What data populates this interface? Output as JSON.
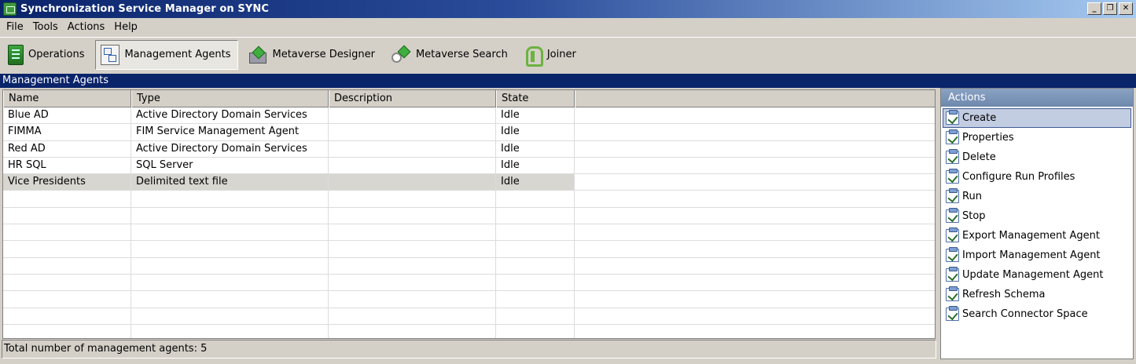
{
  "window": {
    "title": "Synchronization Service Manager on SYNC",
    "controls": {
      "minimize": "_",
      "restore": "❐",
      "close": "✕"
    }
  },
  "menu": [
    "File",
    "Tools",
    "Actions",
    "Help"
  ],
  "toolbar": {
    "items": [
      {
        "label": "Operations",
        "icon": "operations-icon",
        "active": false
      },
      {
        "label": "Management Agents",
        "icon": "management-agents-icon",
        "active": true
      },
      {
        "label": "Metaverse Designer",
        "icon": "metaverse-designer-icon",
        "active": false
      },
      {
        "label": "Metaverse Search",
        "icon": "metaverse-search-icon",
        "active": false
      },
      {
        "label": "Joiner",
        "icon": "joiner-icon",
        "active": false
      }
    ]
  },
  "section": {
    "title": "Management Agents"
  },
  "grid": {
    "columns": [
      "Name",
      "Type",
      "Description",
      "State"
    ],
    "rows": [
      {
        "name": "Blue AD",
        "type": "Active Directory Domain Services",
        "description": "",
        "state": "Idle"
      },
      {
        "name": "FIMMA",
        "type": "FIM Service Management Agent",
        "description": "",
        "state": "Idle"
      },
      {
        "name": "Red AD",
        "type": "Active Directory Domain Services",
        "description": "",
        "state": "Idle"
      },
      {
        "name": "HR SQL",
        "type": "SQL Server",
        "description": "",
        "state": "Idle"
      },
      {
        "name": "Vice Presidents",
        "type": "Delimited text file",
        "description": "",
        "state": "Idle"
      }
    ],
    "selected_row": 4
  },
  "status": {
    "text": "Total number of management agents: 5"
  },
  "actions": {
    "title": "Actions",
    "items": [
      "Create",
      "Properties",
      "Delete",
      "Configure Run Profiles",
      "Run",
      "Stop",
      "Export Management Agent",
      "Import Management Agent",
      "Update Management Agent",
      "Refresh Schema",
      "Search Connector Space"
    ],
    "active_item": 0
  },
  "colors": {
    "title_bar": "#0a246a",
    "section_bar": "#0a246a",
    "window_bg": "#d4d0c8",
    "actions_header": "#7b94b8"
  }
}
